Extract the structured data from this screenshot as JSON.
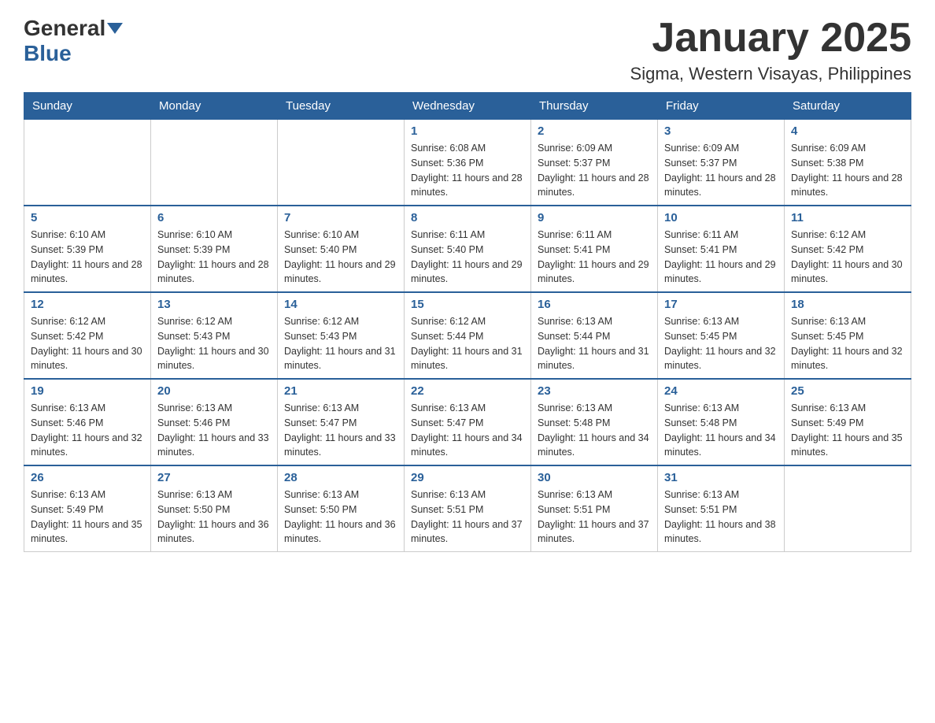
{
  "header": {
    "logo_general": "General",
    "logo_blue": "Blue",
    "month_title": "January 2025",
    "location": "Sigma, Western Visayas, Philippines"
  },
  "days_of_week": [
    "Sunday",
    "Monday",
    "Tuesday",
    "Wednesday",
    "Thursday",
    "Friday",
    "Saturday"
  ],
  "weeks": [
    [
      {
        "day": "",
        "info": ""
      },
      {
        "day": "",
        "info": ""
      },
      {
        "day": "",
        "info": ""
      },
      {
        "day": "1",
        "info": "Sunrise: 6:08 AM\nSunset: 5:36 PM\nDaylight: 11 hours and 28 minutes."
      },
      {
        "day": "2",
        "info": "Sunrise: 6:09 AM\nSunset: 5:37 PM\nDaylight: 11 hours and 28 minutes."
      },
      {
        "day": "3",
        "info": "Sunrise: 6:09 AM\nSunset: 5:37 PM\nDaylight: 11 hours and 28 minutes."
      },
      {
        "day": "4",
        "info": "Sunrise: 6:09 AM\nSunset: 5:38 PM\nDaylight: 11 hours and 28 minutes."
      }
    ],
    [
      {
        "day": "5",
        "info": "Sunrise: 6:10 AM\nSunset: 5:39 PM\nDaylight: 11 hours and 28 minutes."
      },
      {
        "day": "6",
        "info": "Sunrise: 6:10 AM\nSunset: 5:39 PM\nDaylight: 11 hours and 28 minutes."
      },
      {
        "day": "7",
        "info": "Sunrise: 6:10 AM\nSunset: 5:40 PM\nDaylight: 11 hours and 29 minutes."
      },
      {
        "day": "8",
        "info": "Sunrise: 6:11 AM\nSunset: 5:40 PM\nDaylight: 11 hours and 29 minutes."
      },
      {
        "day": "9",
        "info": "Sunrise: 6:11 AM\nSunset: 5:41 PM\nDaylight: 11 hours and 29 minutes."
      },
      {
        "day": "10",
        "info": "Sunrise: 6:11 AM\nSunset: 5:41 PM\nDaylight: 11 hours and 29 minutes."
      },
      {
        "day": "11",
        "info": "Sunrise: 6:12 AM\nSunset: 5:42 PM\nDaylight: 11 hours and 30 minutes."
      }
    ],
    [
      {
        "day": "12",
        "info": "Sunrise: 6:12 AM\nSunset: 5:42 PM\nDaylight: 11 hours and 30 minutes."
      },
      {
        "day": "13",
        "info": "Sunrise: 6:12 AM\nSunset: 5:43 PM\nDaylight: 11 hours and 30 minutes."
      },
      {
        "day": "14",
        "info": "Sunrise: 6:12 AM\nSunset: 5:43 PM\nDaylight: 11 hours and 31 minutes."
      },
      {
        "day": "15",
        "info": "Sunrise: 6:12 AM\nSunset: 5:44 PM\nDaylight: 11 hours and 31 minutes."
      },
      {
        "day": "16",
        "info": "Sunrise: 6:13 AM\nSunset: 5:44 PM\nDaylight: 11 hours and 31 minutes."
      },
      {
        "day": "17",
        "info": "Sunrise: 6:13 AM\nSunset: 5:45 PM\nDaylight: 11 hours and 32 minutes."
      },
      {
        "day": "18",
        "info": "Sunrise: 6:13 AM\nSunset: 5:45 PM\nDaylight: 11 hours and 32 minutes."
      }
    ],
    [
      {
        "day": "19",
        "info": "Sunrise: 6:13 AM\nSunset: 5:46 PM\nDaylight: 11 hours and 32 minutes."
      },
      {
        "day": "20",
        "info": "Sunrise: 6:13 AM\nSunset: 5:46 PM\nDaylight: 11 hours and 33 minutes."
      },
      {
        "day": "21",
        "info": "Sunrise: 6:13 AM\nSunset: 5:47 PM\nDaylight: 11 hours and 33 minutes."
      },
      {
        "day": "22",
        "info": "Sunrise: 6:13 AM\nSunset: 5:47 PM\nDaylight: 11 hours and 34 minutes."
      },
      {
        "day": "23",
        "info": "Sunrise: 6:13 AM\nSunset: 5:48 PM\nDaylight: 11 hours and 34 minutes."
      },
      {
        "day": "24",
        "info": "Sunrise: 6:13 AM\nSunset: 5:48 PM\nDaylight: 11 hours and 34 minutes."
      },
      {
        "day": "25",
        "info": "Sunrise: 6:13 AM\nSunset: 5:49 PM\nDaylight: 11 hours and 35 minutes."
      }
    ],
    [
      {
        "day": "26",
        "info": "Sunrise: 6:13 AM\nSunset: 5:49 PM\nDaylight: 11 hours and 35 minutes."
      },
      {
        "day": "27",
        "info": "Sunrise: 6:13 AM\nSunset: 5:50 PM\nDaylight: 11 hours and 36 minutes."
      },
      {
        "day": "28",
        "info": "Sunrise: 6:13 AM\nSunset: 5:50 PM\nDaylight: 11 hours and 36 minutes."
      },
      {
        "day": "29",
        "info": "Sunrise: 6:13 AM\nSunset: 5:51 PM\nDaylight: 11 hours and 37 minutes."
      },
      {
        "day": "30",
        "info": "Sunrise: 6:13 AM\nSunset: 5:51 PM\nDaylight: 11 hours and 37 minutes."
      },
      {
        "day": "31",
        "info": "Sunrise: 6:13 AM\nSunset: 5:51 PM\nDaylight: 11 hours and 38 minutes."
      },
      {
        "day": "",
        "info": ""
      }
    ]
  ]
}
